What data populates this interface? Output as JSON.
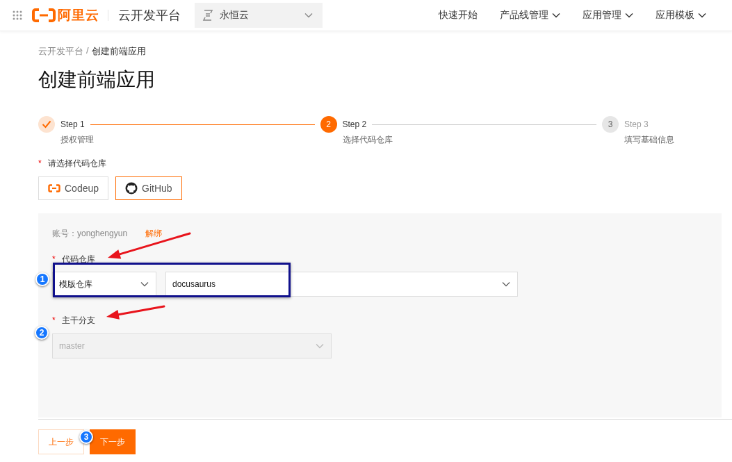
{
  "header": {
    "logo_text": "阿里云",
    "product": "云开发平台",
    "workspace": "永恒云",
    "nav": [
      {
        "label": "快速开始",
        "dropdown": false
      },
      {
        "label": "产品线管理",
        "dropdown": true
      },
      {
        "label": "应用管理",
        "dropdown": true
      },
      {
        "label": "应用模板",
        "dropdown": true
      }
    ]
  },
  "breadcrumb": {
    "items": [
      "云开发平台",
      "创建前端应用"
    ],
    "separator": "/"
  },
  "title": "创建前端应用",
  "steps": [
    {
      "title": "Step 1",
      "description": "授权管理",
      "kind": "done"
    },
    {
      "title": "Step 2",
      "description": "选择代码仓库",
      "kind": "current",
      "number": "2"
    },
    {
      "title": "Step 3",
      "description": "填写基础信息",
      "kind": "wait",
      "number": "3"
    }
  ],
  "source": {
    "label": "请选择代码仓库",
    "required_mark": "*",
    "options": [
      {
        "label": "Codeup",
        "kind": "codeup",
        "selected": false
      },
      {
        "label": "GitHub",
        "kind": "github",
        "selected": true
      }
    ]
  },
  "panel": {
    "account": "账号：yonghengyun",
    "unbind": "解绑",
    "repo": {
      "label": "代码仓库",
      "required_mark": "*",
      "type": "模版仓库",
      "value": "docusaurus"
    },
    "branch": {
      "label": "主干分支",
      "required_mark": "*",
      "value": "master",
      "disabled": true
    }
  },
  "buttons": {
    "prev": "上一步",
    "next": "下一步"
  },
  "annotations": {
    "badges": [
      "1",
      "2",
      "3"
    ]
  }
}
